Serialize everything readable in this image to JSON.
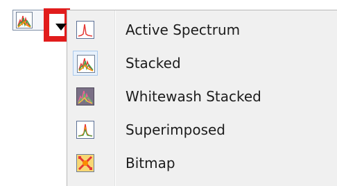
{
  "toolbar": {
    "current_view_icon": "stacked-spectrum-icon",
    "dropdown_icon": "dropdown-arrow-icon",
    "highlight_color": "#e11c1c"
  },
  "menu": {
    "items": [
      {
        "label": "Active Spectrum",
        "icon": "active-spectrum-icon",
        "checked": false
      },
      {
        "label": "Stacked",
        "icon": "stacked-spectrum-icon",
        "checked": true
      },
      {
        "label": "Whitewash Stacked",
        "icon": "whitewash-stacked-icon",
        "checked": false
      },
      {
        "label": "Superimposed",
        "icon": "superimposed-icon",
        "checked": false
      },
      {
        "label": "Bitmap",
        "icon": "bitmap-icon",
        "checked": false
      }
    ]
  }
}
